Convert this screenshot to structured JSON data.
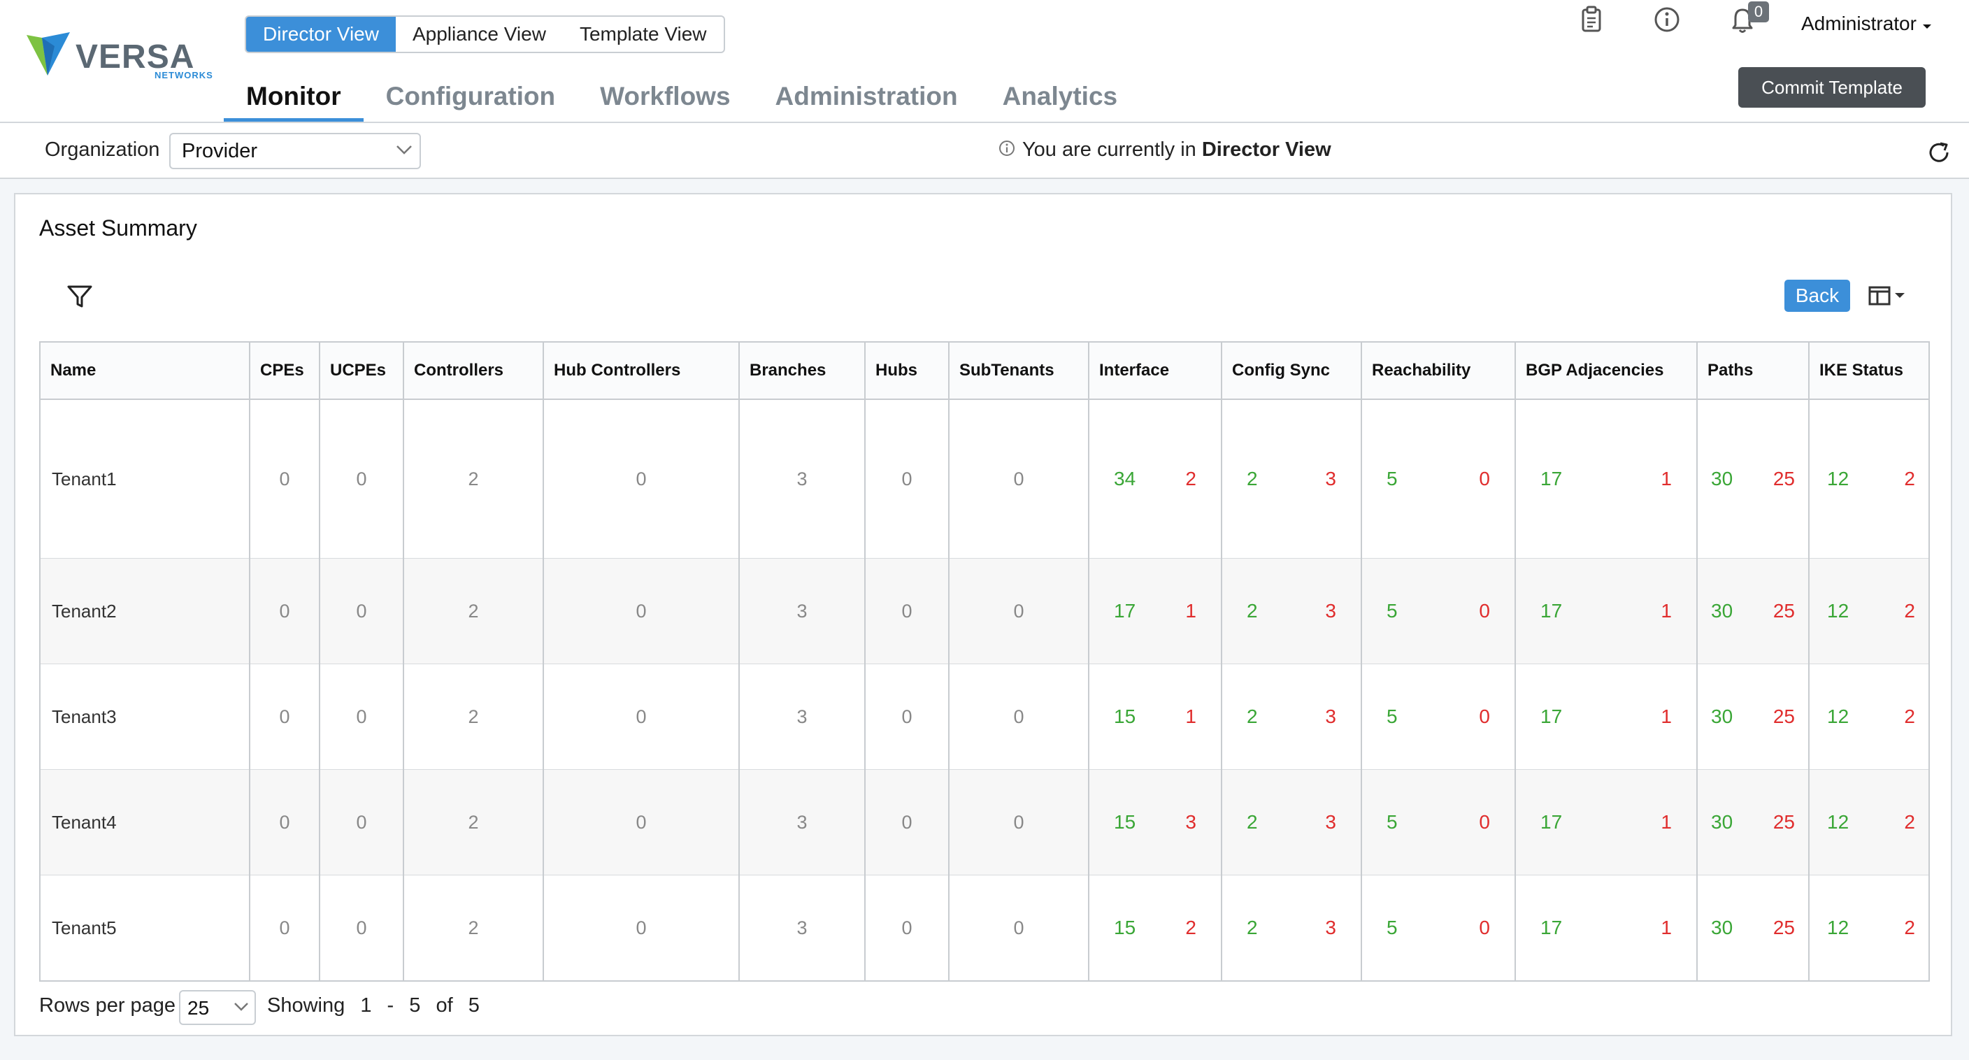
{
  "logo": {
    "name": "VERSA",
    "sub": "NETWORKS"
  },
  "view_switch": [
    "Director View",
    "Appliance View",
    "Template View"
  ],
  "nav": [
    "Monitor",
    "Configuration",
    "Workflows",
    "Administration",
    "Analytics"
  ],
  "notification_count": "0",
  "user": "Administrator",
  "commit_label": "Commit Template",
  "org": {
    "label": "Organization",
    "value": "Provider"
  },
  "view_note": {
    "prefix": "You are currently in",
    "view": "Director View"
  },
  "panel_title": "Asset Summary",
  "back_label": "Back",
  "table": {
    "columns": [
      "Name",
      "CPEs",
      "UCPEs",
      "Controllers",
      "Hub Controllers",
      "Branches",
      "Hubs",
      "SubTenants",
      "Interface",
      "Config Sync",
      "Reachability",
      "BGP Adjacencies",
      "Paths",
      "IKE Status"
    ],
    "rows": [
      {
        "name": "Tenant1",
        "cpes": "0",
        "ucpes": "0",
        "controllers": "2",
        "hub_controllers": "0",
        "branches": "3",
        "hubs": "0",
        "subtenants": "0",
        "interface": [
          "34",
          "2"
        ],
        "config_sync": [
          "2",
          "3"
        ],
        "reachability": [
          "5",
          "0"
        ],
        "bgp": [
          "17",
          "1"
        ],
        "paths": [
          "30",
          "25"
        ],
        "ike": [
          "12",
          "2"
        ]
      },
      {
        "name": "Tenant2",
        "cpes": "0",
        "ucpes": "0",
        "controllers": "2",
        "hub_controllers": "0",
        "branches": "3",
        "hubs": "0",
        "subtenants": "0",
        "interface": [
          "17",
          "1"
        ],
        "config_sync": [
          "2",
          "3"
        ],
        "reachability": [
          "5",
          "0"
        ],
        "bgp": [
          "17",
          "1"
        ],
        "paths": [
          "30",
          "25"
        ],
        "ike": [
          "12",
          "2"
        ]
      },
      {
        "name": "Tenant3",
        "cpes": "0",
        "ucpes": "0",
        "controllers": "2",
        "hub_controllers": "0",
        "branches": "3",
        "hubs": "0",
        "subtenants": "0",
        "interface": [
          "15",
          "1"
        ],
        "config_sync": [
          "2",
          "3"
        ],
        "reachability": [
          "5",
          "0"
        ],
        "bgp": [
          "17",
          "1"
        ],
        "paths": [
          "30",
          "25"
        ],
        "ike": [
          "12",
          "2"
        ]
      },
      {
        "name": "Tenant4",
        "cpes": "0",
        "ucpes": "0",
        "controllers": "2",
        "hub_controllers": "0",
        "branches": "3",
        "hubs": "0",
        "subtenants": "0",
        "interface": [
          "15",
          "3"
        ],
        "config_sync": [
          "2",
          "3"
        ],
        "reachability": [
          "5",
          "0"
        ],
        "bgp": [
          "17",
          "1"
        ],
        "paths": [
          "30",
          "25"
        ],
        "ike": [
          "12",
          "2"
        ]
      },
      {
        "name": "Tenant5",
        "cpes": "0",
        "ucpes": "0",
        "controllers": "2",
        "hub_controllers": "0",
        "branches": "3",
        "hubs": "0",
        "subtenants": "0",
        "interface": [
          "15",
          "2"
        ],
        "config_sync": [
          "2",
          "3"
        ],
        "reachability": [
          "5",
          "0"
        ],
        "bgp": [
          "17",
          "1"
        ],
        "paths": [
          "30",
          "25"
        ],
        "ike": [
          "12",
          "2"
        ]
      }
    ]
  },
  "footer": {
    "rows_per_page_label": "Rows per page",
    "rows_per_page": "25",
    "showing_label": "Showing",
    "from": "1",
    "dash": "-",
    "to": "5",
    "of_label": "of",
    "total": "5"
  },
  "colors": {
    "accent": "#3c8fd9",
    "ok": "#3aa636",
    "bad": "#e02d2d",
    "commit": "#4a4f54"
  },
  "icons": [
    "clipboard-icon",
    "info-icon",
    "bell-icon",
    "caret-down-icon",
    "chevron-down-icon",
    "refresh-icon",
    "filter-icon",
    "columns-icon"
  ]
}
